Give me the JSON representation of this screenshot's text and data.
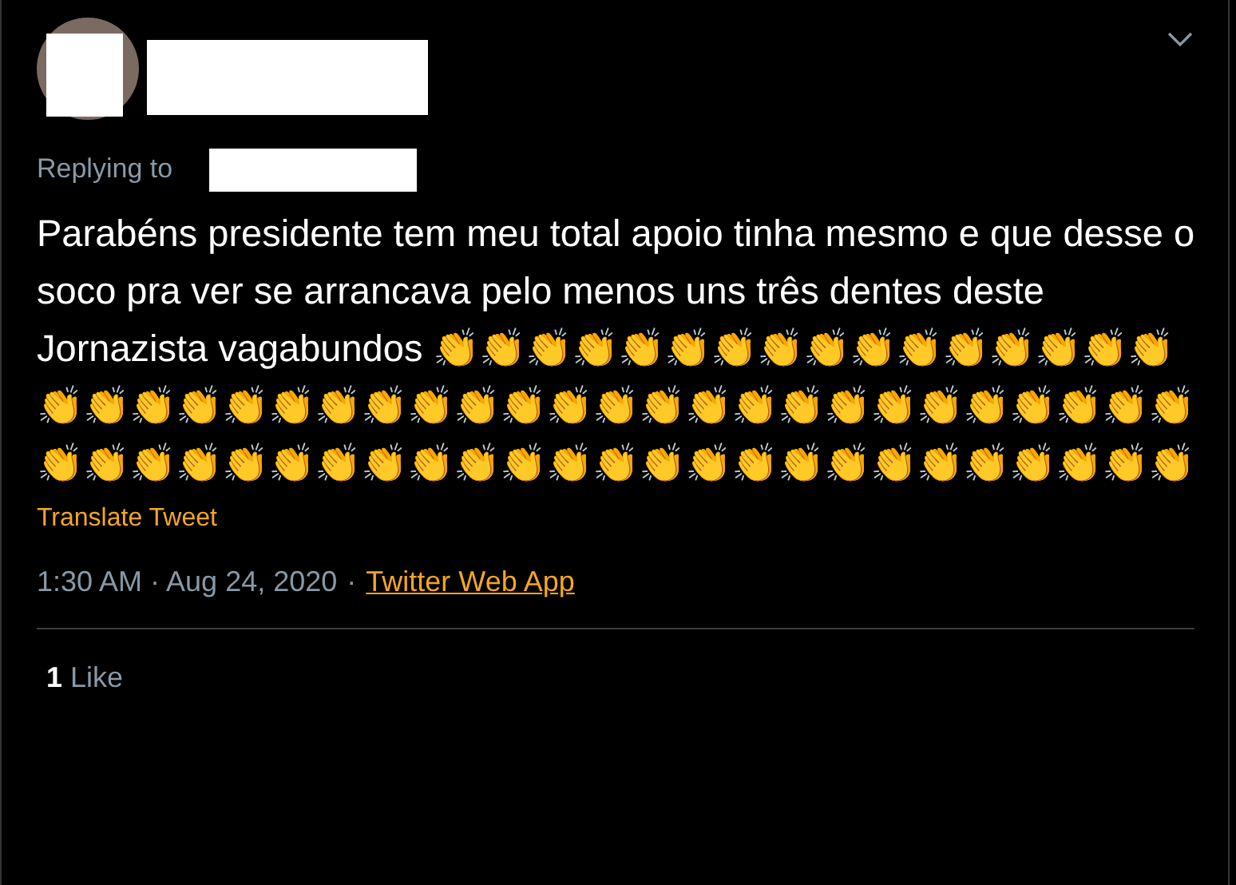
{
  "tweet": {
    "replying_label": "Replying to",
    "text": "Parabéns presidente tem meu total apoio tinha mesmo e que desse o soco pra ver se  arrancava pelo menos uns três dentes deste Jornazista vagabundos 👏👏👏👏👏👏👏👏👏👏👏👏👏👏👏👏👏👏👏👏👏👏👏👏👏👏👏👏👏👏👏👏👏👏👏👏👏👏👏👏👏👏👏👏👏👏👏👏👏👏👏👏👏👏👏👏👏👏👏👏👏👏👏👏👏👏",
    "translate": "Translate Tweet",
    "time": "1:30 AM · Aug 24, 2020",
    "separator": "·",
    "source": "Twitter Web App",
    "likes_count": "1",
    "likes_label": "Like"
  }
}
